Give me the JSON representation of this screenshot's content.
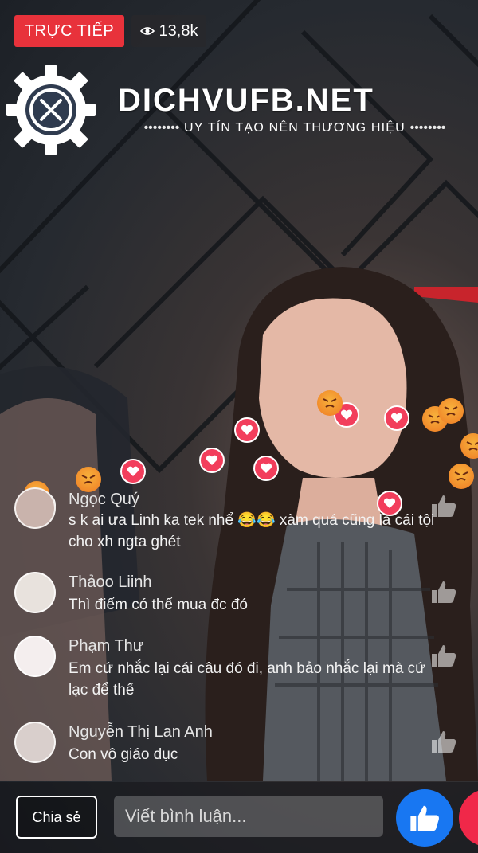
{
  "live": {
    "badge": "TRỰC TIẾP",
    "viewers": "13,8k"
  },
  "brand": {
    "title": "DICHVUFB.NET",
    "tagline": "UY TÍN TẠO NÊN THƯƠNG HIỆU",
    "tagline_dots_left": "••••••••",
    "tagline_dots_right": "••••••••"
  },
  "comments": [
    {
      "name": "Ngọc Quý",
      "text": "s k ai ưa Linh ka tek nhể 😂😂 xàm quá cũng là cái tội cho xh ngta ghét"
    },
    {
      "name": "Thảoo Liinh",
      "text": "Thì điểm có thể mua đc đó"
    },
    {
      "name": "Phạm Thư",
      "text": "Em cứ nhắc lại cái câu đó đi, anh bảo nhắc lại mà cứ lạc để thế"
    },
    {
      "name": "Nguyễn Thị Lan Anh",
      "text": "Con vô giáo dục"
    }
  ],
  "footer": {
    "share_label": "Chia sẻ",
    "comment_placeholder": "Viết bình luận..."
  },
  "colors": {
    "live_red": "#e8323b",
    "like_blue": "#1877f2",
    "love_red": "#f02849"
  },
  "icons": [
    "eye-icon",
    "gear-logo-icon",
    "heart-reaction-icon",
    "angry-reaction-icon",
    "thumbs-up-icon"
  ]
}
